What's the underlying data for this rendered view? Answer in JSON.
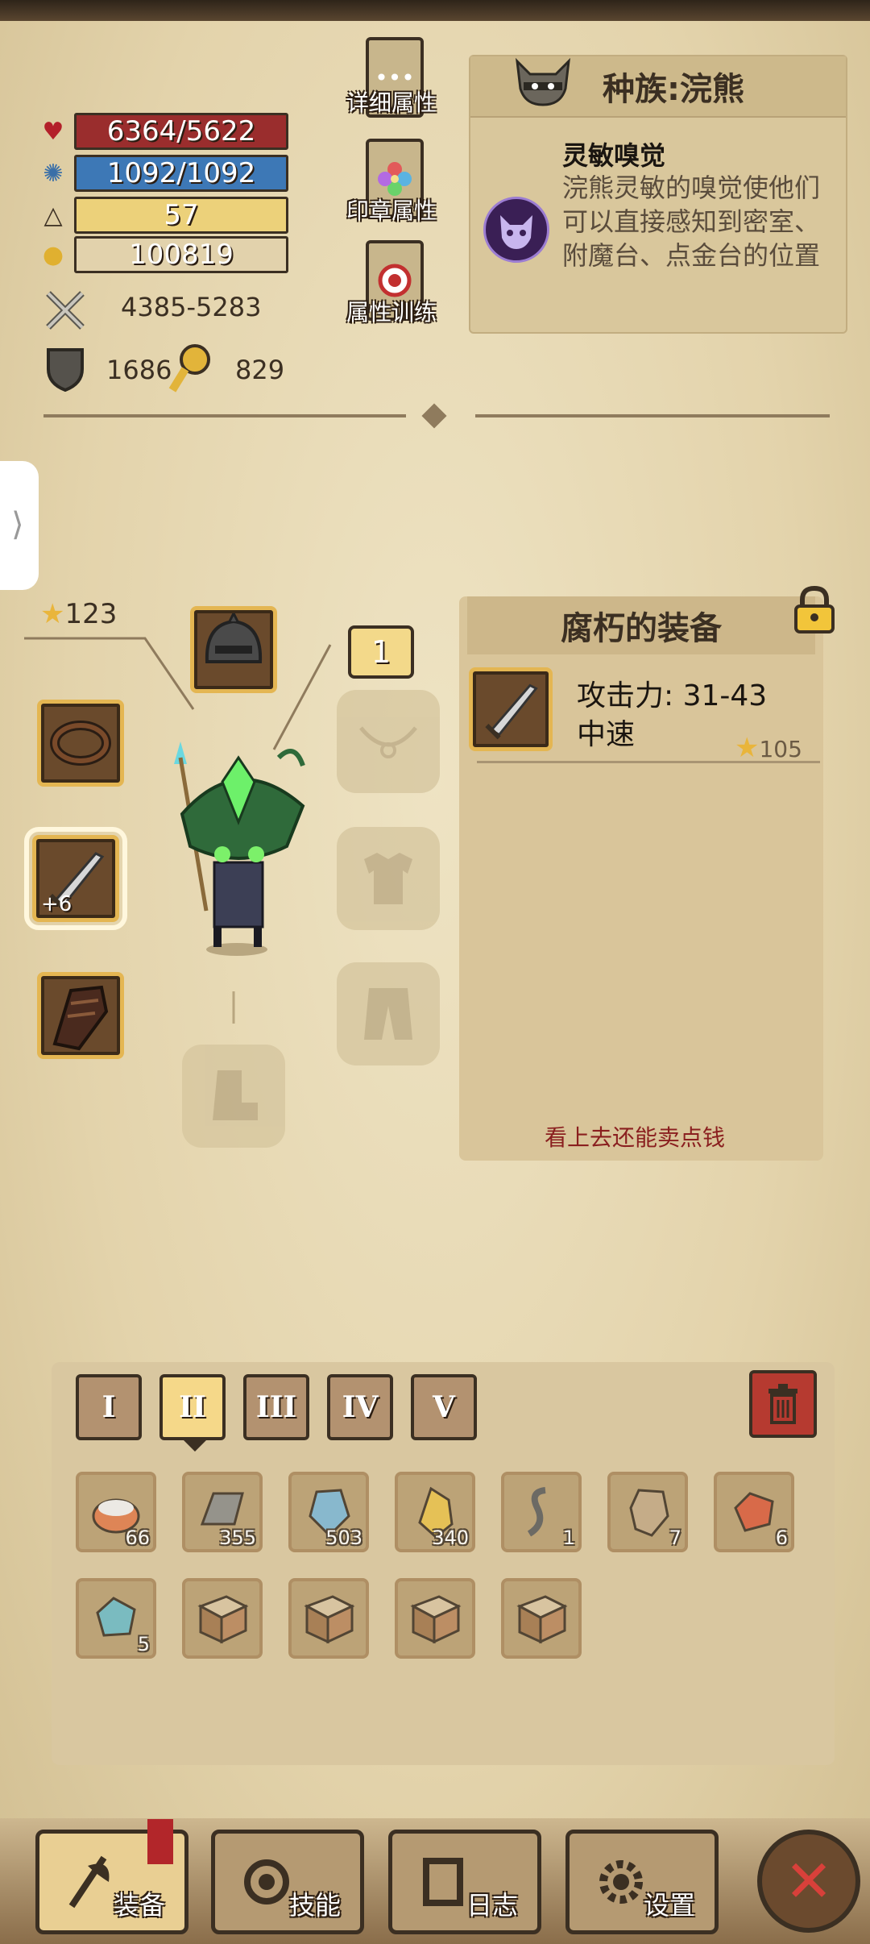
{
  "stats": {
    "hp": "6364/5622",
    "mp": "1092/1092",
    "level": "57",
    "gold": "100819",
    "attack": "4385-5283",
    "armor": "1686",
    "resist": "829"
  },
  "side_buttons": {
    "detail": "详细属性",
    "seal": "印章属性",
    "training": "属性训练"
  },
  "race": {
    "title": "种族:浣熊",
    "trait_name": "灵敏嗅觉",
    "trait_desc": "浣熊灵敏的嗅觉使他们可以直接感知到密室、附魔台、点金台的位置"
  },
  "equipment": {
    "score": "123",
    "ring_count": "1",
    "weapon_plus": "+6"
  },
  "item": {
    "name": "腐朽的装备",
    "attack": "攻击力: 31-43",
    "speed": "中速",
    "score": "105",
    "flavor": "看上去还能卖点钱"
  },
  "inventory": {
    "tiers": [
      "I",
      "II",
      "III",
      "IV",
      "V"
    ],
    "active_tier": 1,
    "items": [
      {
        "icon": "bowl-icon",
        "count": "66"
      },
      {
        "icon": "iron-ingot-icon",
        "count": "355"
      },
      {
        "icon": "blue-crystal-icon",
        "count": "503"
      },
      {
        "icon": "yellow-crystal-icon",
        "count": "340"
      },
      {
        "icon": "serpent-icon",
        "count": "1"
      },
      {
        "icon": "gauntlet-icon",
        "count": "7"
      },
      {
        "icon": "red-gem-icon",
        "count": "6"
      },
      {
        "icon": "blue-gem-icon",
        "count": "5"
      },
      {
        "icon": "book-icon",
        "count": ""
      },
      {
        "icon": "book-icon",
        "count": ""
      },
      {
        "icon": "book-icon",
        "count": ""
      },
      {
        "icon": "book-icon",
        "count": ""
      }
    ]
  },
  "nav": {
    "equip": "装备",
    "skills": "技能",
    "log": "日志",
    "settings": "设置"
  }
}
